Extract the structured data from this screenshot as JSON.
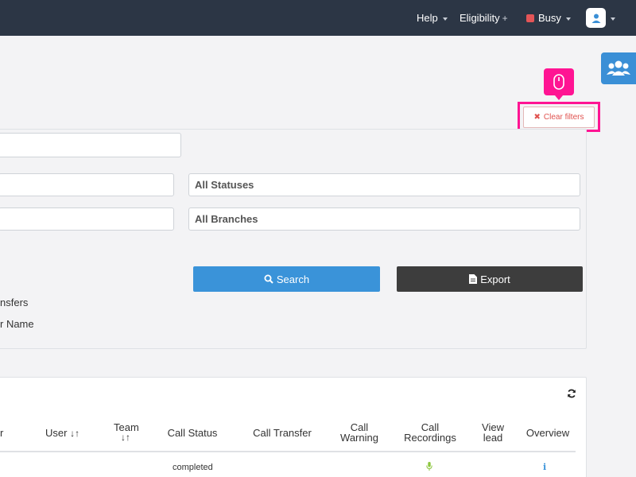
{
  "nav": {
    "help": "Help",
    "eligibility": "Eligibility",
    "busy": "Busy"
  },
  "filters": {
    "clear_label": "Clear filters",
    "statuses_placeholder": "All Statuses",
    "branches_placeholder": "All Branches",
    "search_label": "Search",
    "export_label": "Export",
    "option_transfers_partial": "nsfers",
    "option_name_partial": "r Name"
  },
  "table": {
    "partial_header": "r",
    "headers": {
      "user": "User",
      "team": "Team",
      "call_status": "Call Status",
      "call_transfer": "Call Transfer",
      "call_warning_1": "Call",
      "call_warning_2": "Warning",
      "call_recordings_1": "Call",
      "call_recordings_2": "Recordings",
      "view_lead_1": "View",
      "view_lead_2": "lead",
      "overview": "Overview"
    },
    "rows": [
      {
        "call_status": "completed",
        "overview_icon": "i"
      }
    ]
  },
  "colors": {
    "topbar": "#2c3645",
    "accent_blue": "#3a93d9",
    "highlight": "#ff1493",
    "danger": "#e0524f"
  }
}
